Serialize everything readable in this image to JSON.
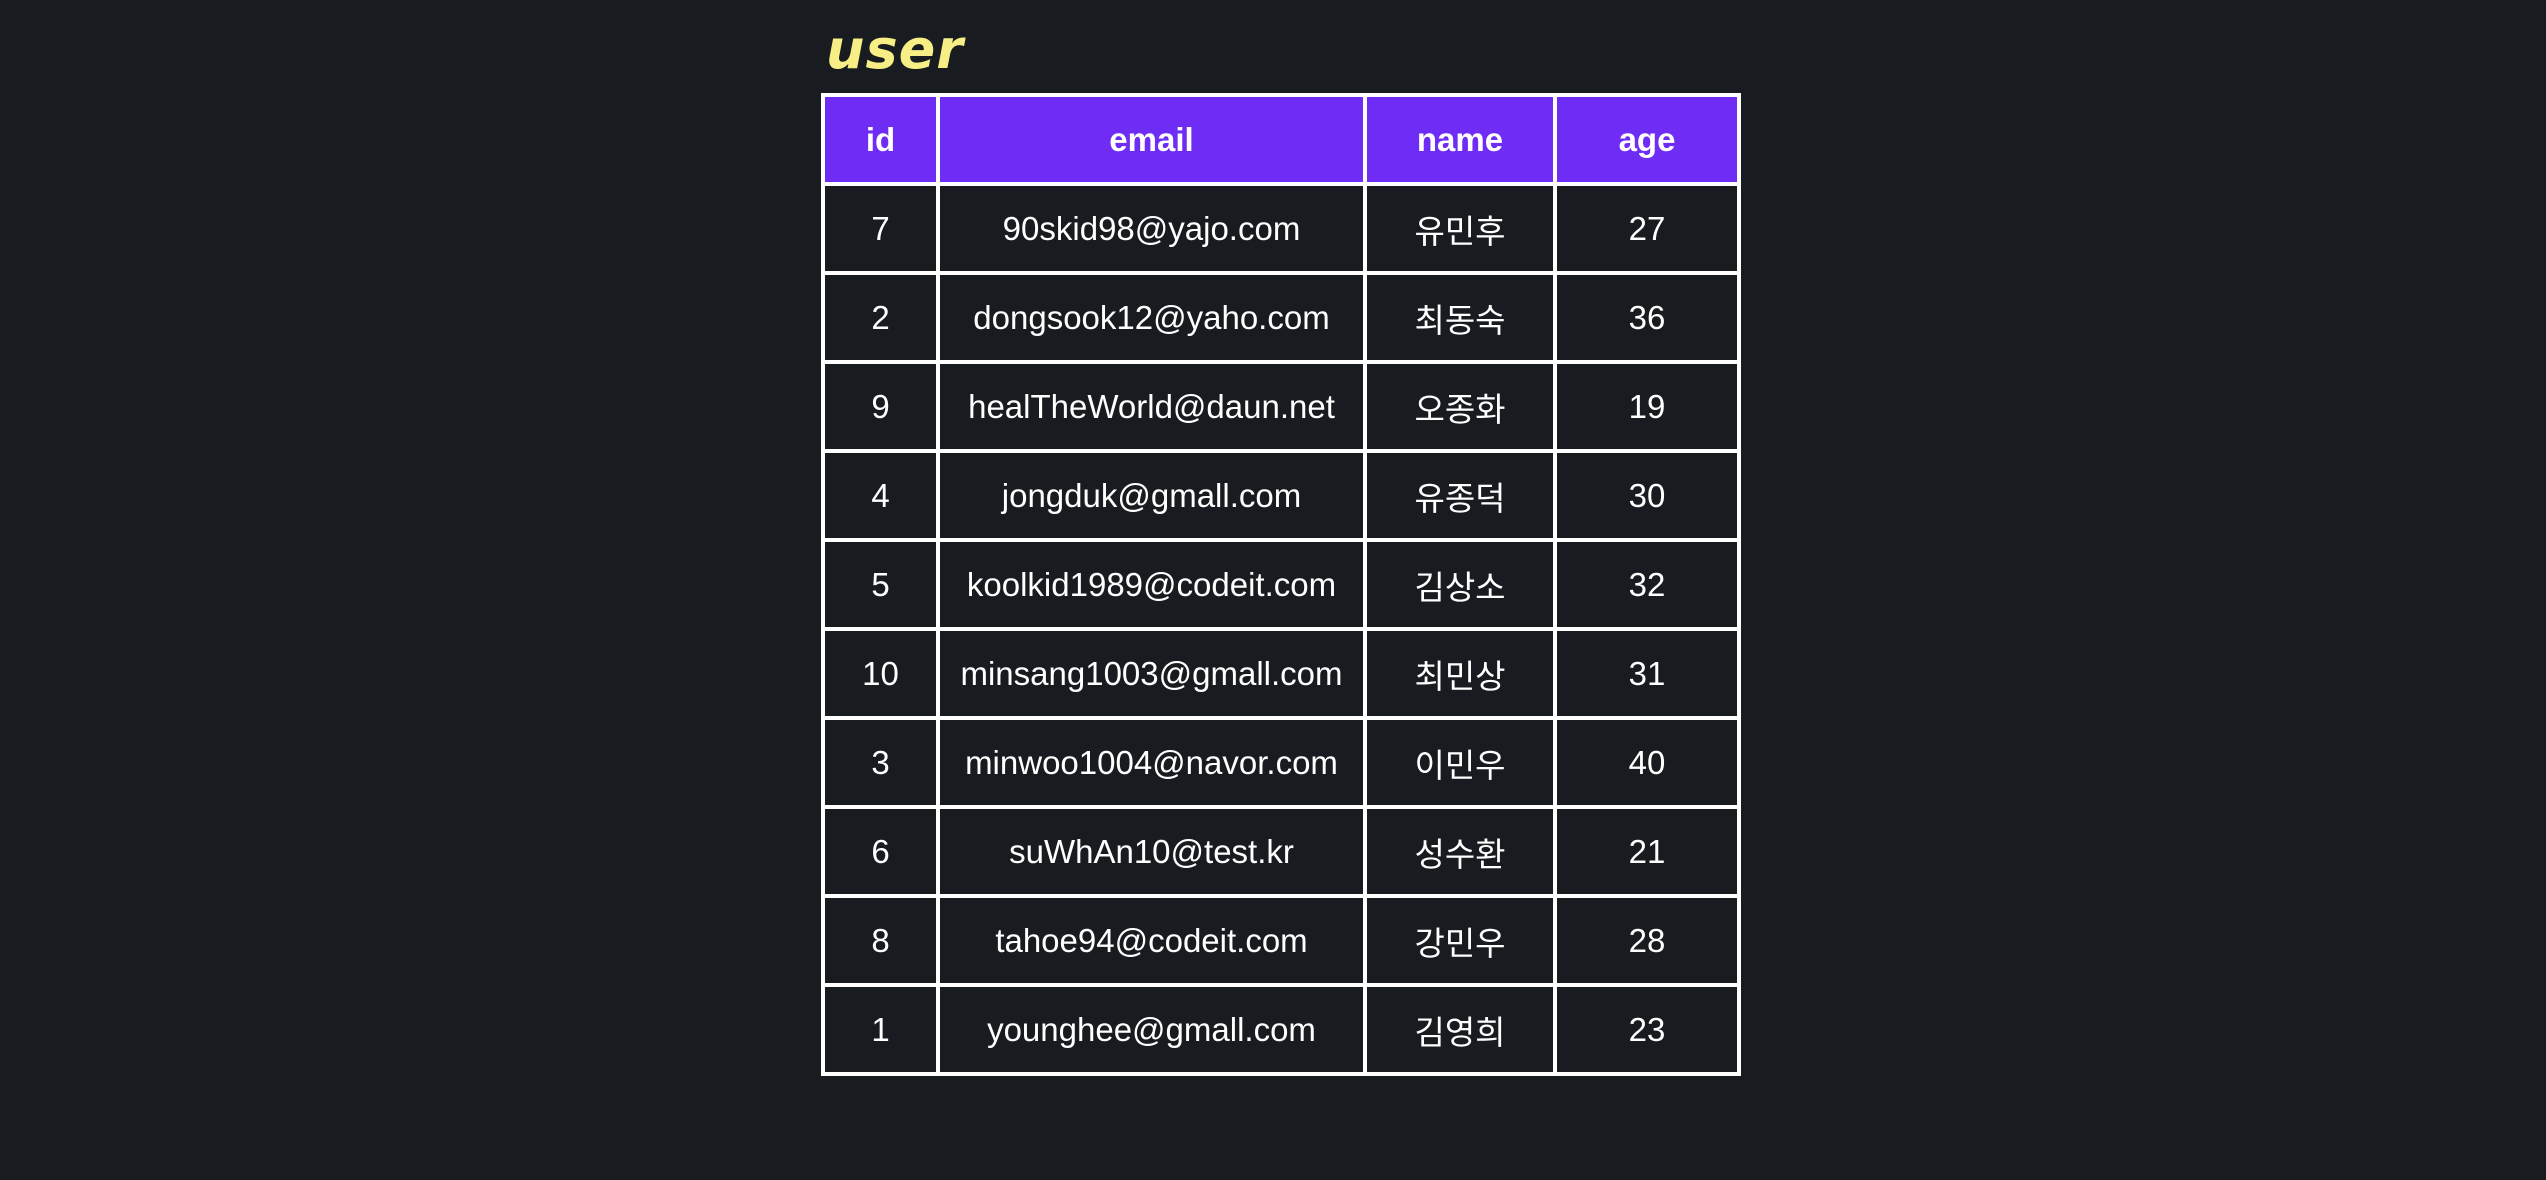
{
  "table_title": "user",
  "columns": [
    "id",
    "email",
    "name",
    "age"
  ],
  "rows": [
    {
      "id": "7",
      "email": "90skid98@yajo.com",
      "name": "유민후",
      "age": "27"
    },
    {
      "id": "2",
      "email": "dongsook12@yaho.com",
      "name": "최동숙",
      "age": "36"
    },
    {
      "id": "9",
      "email": "healTheWorld@daun.net",
      "name": "오종화",
      "age": "19"
    },
    {
      "id": "4",
      "email": "jongduk@gmall.com",
      "name": "유종덕",
      "age": "30"
    },
    {
      "id": "5",
      "email": "koolkid1989@codeit.com",
      "name": "김상소",
      "age": "32"
    },
    {
      "id": "10",
      "email": "minsang1003@gmall.com",
      "name": "최민상",
      "age": "31"
    },
    {
      "id": "3",
      "email": "minwoo1004@navor.com",
      "name": "이민우",
      "age": "40"
    },
    {
      "id": "6",
      "email": "suWhAn10@test.kr",
      "name": "성수환",
      "age": "21"
    },
    {
      "id": "8",
      "email": "tahoe94@codeit.com",
      "name": "강민우",
      "age": "28"
    },
    {
      "id": "1",
      "email": "younghee@gmall.com",
      "name": "김영희",
      "age": "23"
    }
  ],
  "colors": {
    "background": "#181b20",
    "header_background": "#6f2cf4",
    "title_color": "#f7ef86",
    "border": "#ffffff",
    "text": "#ffffff"
  }
}
